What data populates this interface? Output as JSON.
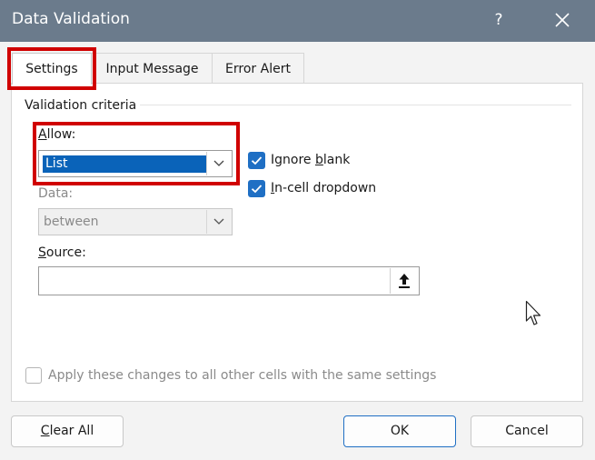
{
  "window": {
    "title": "Data Validation",
    "help_glyph": "?",
    "close_icon": "close-icon"
  },
  "tabs": [
    {
      "label": "Settings",
      "active": true
    },
    {
      "label": "Input Message",
      "active": false
    },
    {
      "label": "Error Alert",
      "active": false
    }
  ],
  "settings": {
    "group_label": "Validation criteria",
    "allow": {
      "label_key": "A",
      "label_rest": "llow:",
      "value": "List"
    },
    "ignore_blank": {
      "label_pre": "Ignore ",
      "label_key": "b",
      "label_rest": "lank",
      "checked": true
    },
    "in_cell_dropdown": {
      "label_key": "I",
      "label_rest": "n-cell dropdown",
      "checked": true
    },
    "data": {
      "label": "Data:",
      "value": "between",
      "enabled": false
    },
    "source": {
      "label_key": "S",
      "label_rest": "ource:",
      "value": ""
    },
    "apply_all": {
      "label": "Apply these changes to all other cells with the same settings",
      "checked": false,
      "enabled": false
    }
  },
  "buttons": {
    "clear_all_key": "C",
    "clear_all_rest": "lear All",
    "ok": "OK",
    "cancel": "Cancel"
  },
  "colors": {
    "titlebar": "#6b7b8c",
    "accent": "#1f6fc4",
    "selection": "#0a63b9",
    "highlight_box": "#d00000"
  }
}
